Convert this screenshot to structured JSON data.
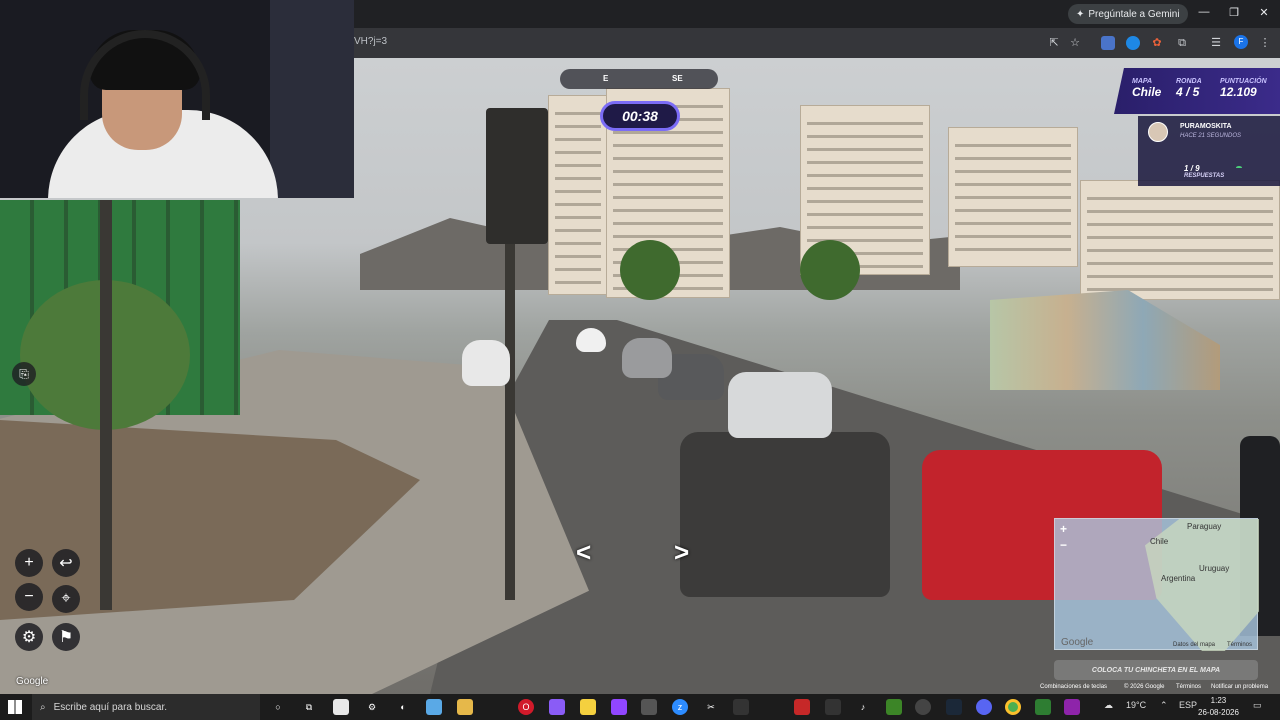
{
  "browser": {
    "url_fragment": "VH?j=3",
    "gemini_label": "Pregúntale a Gemini",
    "profile_initial": "F"
  },
  "game": {
    "compass": {
      "left": "E",
      "right": "SE"
    },
    "timer": "00:38",
    "score": {
      "map_label": "MAPA",
      "map_value": "Chile",
      "round_label": "RONDA",
      "round_value": "4 / 5",
      "points_label": "PUNTUACIÓN",
      "points_value": "12.109"
    },
    "guess": {
      "player": "PURAMOSKITA",
      "time": "HACE 21 SEGUNDOS",
      "count": "1 / 9",
      "count_label": "RESPUESTAS"
    },
    "minimap": {
      "labels": [
        "Paraguay",
        "Chile",
        "Uruguay",
        "Argentina"
      ],
      "zoom_in": "+",
      "zoom_out": "−",
      "brand": "Google",
      "data_label": "Datos del mapa",
      "terms": "Términos"
    },
    "place_pin": "COLOCA TU CHINCHETA EN EL MAPA",
    "watermark": "Google",
    "footer": {
      "shortcuts": "Combinaciones de teclas",
      "copyright": "© 2026 Google",
      "terms": "Términos",
      "report": "Notificar un problema"
    },
    "controls": {
      "zoom_in": "+",
      "zoom_out": "−",
      "back": "↩",
      "checkpoint": "⌖",
      "settings": "⚙",
      "flag": "⚑",
      "share": "⎘"
    },
    "arrows": {
      "left": "<",
      "right": ">"
    }
  },
  "taskbar": {
    "search_placeholder": "Escribe aquí para buscar.",
    "weather": "19°C",
    "language": "ESP",
    "time": "1:23",
    "date": "26-08-2026"
  },
  "colors": {
    "accent": "#7b6cf6",
    "panel": "#2a1f6a"
  }
}
